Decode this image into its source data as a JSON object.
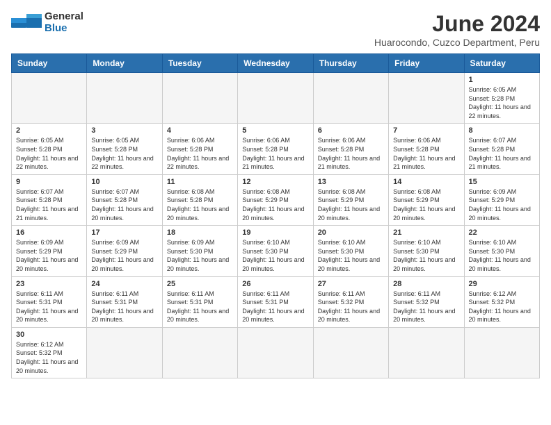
{
  "header": {
    "logo_general": "General",
    "logo_blue": "Blue",
    "month_title": "June 2024",
    "subtitle": "Huarocondo, Cuzco Department, Peru"
  },
  "days_of_week": [
    "Sunday",
    "Monday",
    "Tuesday",
    "Wednesday",
    "Thursday",
    "Friday",
    "Saturday"
  ],
  "weeks": [
    [
      {
        "day": "",
        "info": ""
      },
      {
        "day": "",
        "info": ""
      },
      {
        "day": "",
        "info": ""
      },
      {
        "day": "",
        "info": ""
      },
      {
        "day": "",
        "info": ""
      },
      {
        "day": "",
        "info": ""
      },
      {
        "day": "1",
        "info": "Sunrise: 6:05 AM\nSunset: 5:28 PM\nDaylight: 11 hours and 22 minutes."
      }
    ],
    [
      {
        "day": "2",
        "info": "Sunrise: 6:05 AM\nSunset: 5:28 PM\nDaylight: 11 hours and 22 minutes."
      },
      {
        "day": "3",
        "info": "Sunrise: 6:05 AM\nSunset: 5:28 PM\nDaylight: 11 hours and 22 minutes."
      },
      {
        "day": "4",
        "info": "Sunrise: 6:06 AM\nSunset: 5:28 PM\nDaylight: 11 hours and 22 minutes."
      },
      {
        "day": "5",
        "info": "Sunrise: 6:06 AM\nSunset: 5:28 PM\nDaylight: 11 hours and 21 minutes."
      },
      {
        "day": "6",
        "info": "Sunrise: 6:06 AM\nSunset: 5:28 PM\nDaylight: 11 hours and 21 minutes."
      },
      {
        "day": "7",
        "info": "Sunrise: 6:06 AM\nSunset: 5:28 PM\nDaylight: 11 hours and 21 minutes."
      },
      {
        "day": "8",
        "info": "Sunrise: 6:07 AM\nSunset: 5:28 PM\nDaylight: 11 hours and 21 minutes."
      }
    ],
    [
      {
        "day": "9",
        "info": "Sunrise: 6:07 AM\nSunset: 5:28 PM\nDaylight: 11 hours and 21 minutes."
      },
      {
        "day": "10",
        "info": "Sunrise: 6:07 AM\nSunset: 5:28 PM\nDaylight: 11 hours and 20 minutes."
      },
      {
        "day": "11",
        "info": "Sunrise: 6:08 AM\nSunset: 5:28 PM\nDaylight: 11 hours and 20 minutes."
      },
      {
        "day": "12",
        "info": "Sunrise: 6:08 AM\nSunset: 5:29 PM\nDaylight: 11 hours and 20 minutes."
      },
      {
        "day": "13",
        "info": "Sunrise: 6:08 AM\nSunset: 5:29 PM\nDaylight: 11 hours and 20 minutes."
      },
      {
        "day": "14",
        "info": "Sunrise: 6:08 AM\nSunset: 5:29 PM\nDaylight: 11 hours and 20 minutes."
      },
      {
        "day": "15",
        "info": "Sunrise: 6:09 AM\nSunset: 5:29 PM\nDaylight: 11 hours and 20 minutes."
      }
    ],
    [
      {
        "day": "16",
        "info": "Sunrise: 6:09 AM\nSunset: 5:29 PM\nDaylight: 11 hours and 20 minutes."
      },
      {
        "day": "17",
        "info": "Sunrise: 6:09 AM\nSunset: 5:29 PM\nDaylight: 11 hours and 20 minutes."
      },
      {
        "day": "18",
        "info": "Sunrise: 6:09 AM\nSunset: 5:30 PM\nDaylight: 11 hours and 20 minutes."
      },
      {
        "day": "19",
        "info": "Sunrise: 6:10 AM\nSunset: 5:30 PM\nDaylight: 11 hours and 20 minutes."
      },
      {
        "day": "20",
        "info": "Sunrise: 6:10 AM\nSunset: 5:30 PM\nDaylight: 11 hours and 20 minutes."
      },
      {
        "day": "21",
        "info": "Sunrise: 6:10 AM\nSunset: 5:30 PM\nDaylight: 11 hours and 20 minutes."
      },
      {
        "day": "22",
        "info": "Sunrise: 6:10 AM\nSunset: 5:30 PM\nDaylight: 11 hours and 20 minutes."
      }
    ],
    [
      {
        "day": "23",
        "info": "Sunrise: 6:11 AM\nSunset: 5:31 PM\nDaylight: 11 hours and 20 minutes."
      },
      {
        "day": "24",
        "info": "Sunrise: 6:11 AM\nSunset: 5:31 PM\nDaylight: 11 hours and 20 minutes."
      },
      {
        "day": "25",
        "info": "Sunrise: 6:11 AM\nSunset: 5:31 PM\nDaylight: 11 hours and 20 minutes."
      },
      {
        "day": "26",
        "info": "Sunrise: 6:11 AM\nSunset: 5:31 PM\nDaylight: 11 hours and 20 minutes."
      },
      {
        "day": "27",
        "info": "Sunrise: 6:11 AM\nSunset: 5:32 PM\nDaylight: 11 hours and 20 minutes."
      },
      {
        "day": "28",
        "info": "Sunrise: 6:11 AM\nSunset: 5:32 PM\nDaylight: 11 hours and 20 minutes."
      },
      {
        "day": "29",
        "info": "Sunrise: 6:12 AM\nSunset: 5:32 PM\nDaylight: 11 hours and 20 minutes."
      }
    ],
    [
      {
        "day": "30",
        "info": "Sunrise: 6:12 AM\nSunset: 5:32 PM\nDaylight: 11 hours and 20 minutes."
      },
      {
        "day": "",
        "info": ""
      },
      {
        "day": "",
        "info": ""
      },
      {
        "day": "",
        "info": ""
      },
      {
        "day": "",
        "info": ""
      },
      {
        "day": "",
        "info": ""
      },
      {
        "day": "",
        "info": ""
      }
    ]
  ]
}
